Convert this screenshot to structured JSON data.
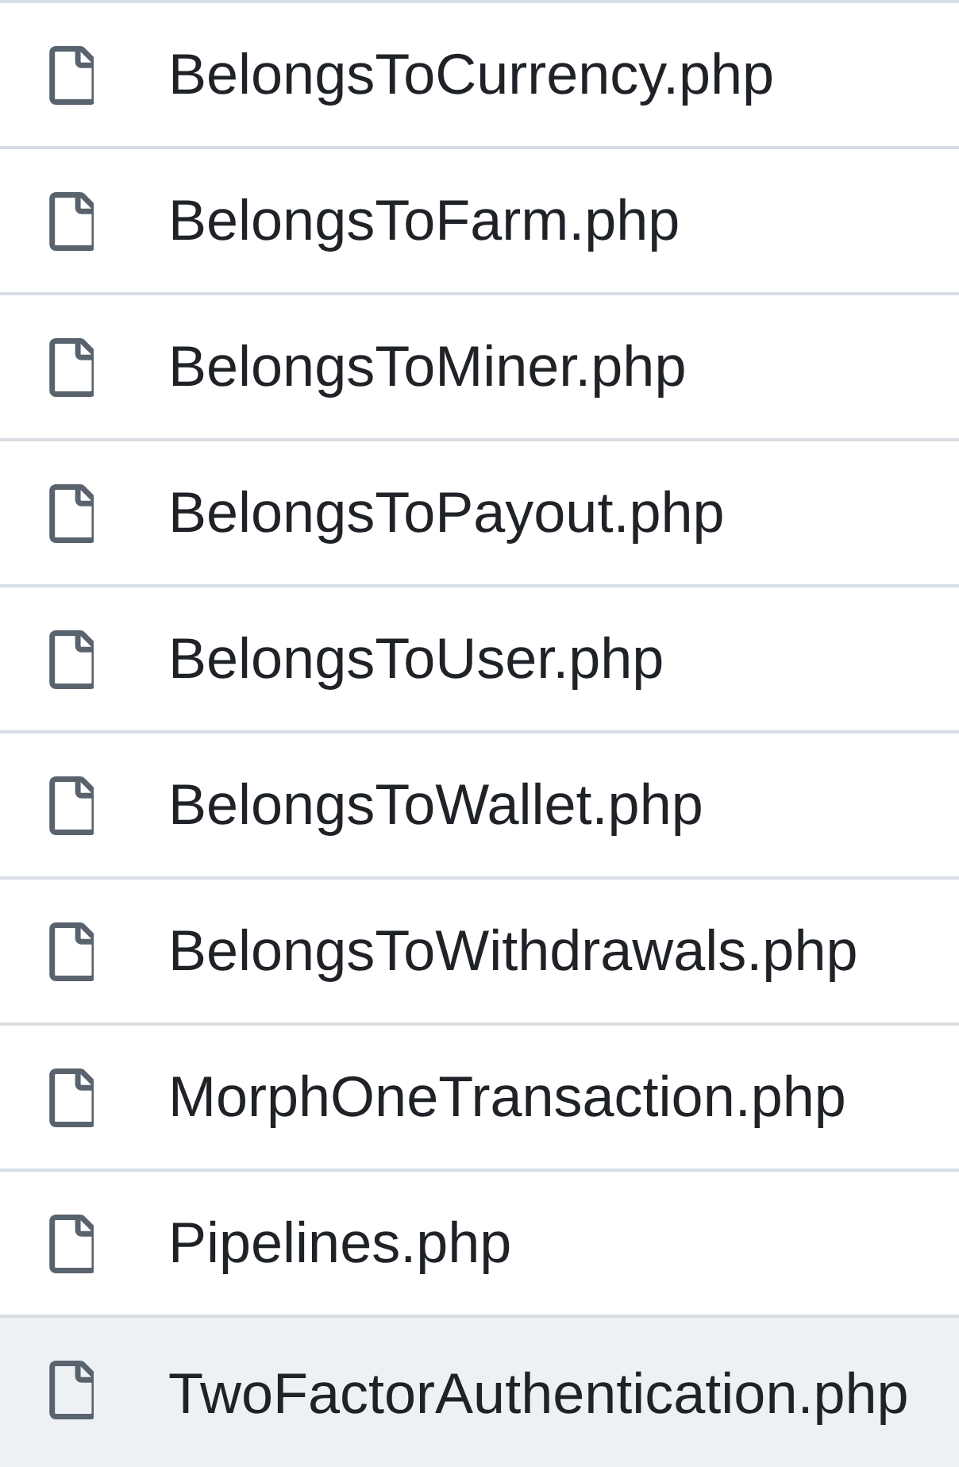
{
  "files": [
    {
      "name": "BelongsToCurrency.php",
      "highlighted": false
    },
    {
      "name": "BelongsToFarm.php",
      "highlighted": false
    },
    {
      "name": "BelongsToMiner.php",
      "highlighted": false
    },
    {
      "name": "BelongsToPayout.php",
      "highlighted": false
    },
    {
      "name": "BelongsToUser.php",
      "highlighted": false
    },
    {
      "name": "BelongsToWallet.php",
      "highlighted": false
    },
    {
      "name": "BelongsToWithdrawals.php",
      "highlighted": false
    },
    {
      "name": "MorphOneTransaction.php",
      "highlighted": false
    },
    {
      "name": "Pipelines.php",
      "highlighted": false
    },
    {
      "name": "TwoFactorAuthentication.php",
      "highlighted": true
    }
  ]
}
